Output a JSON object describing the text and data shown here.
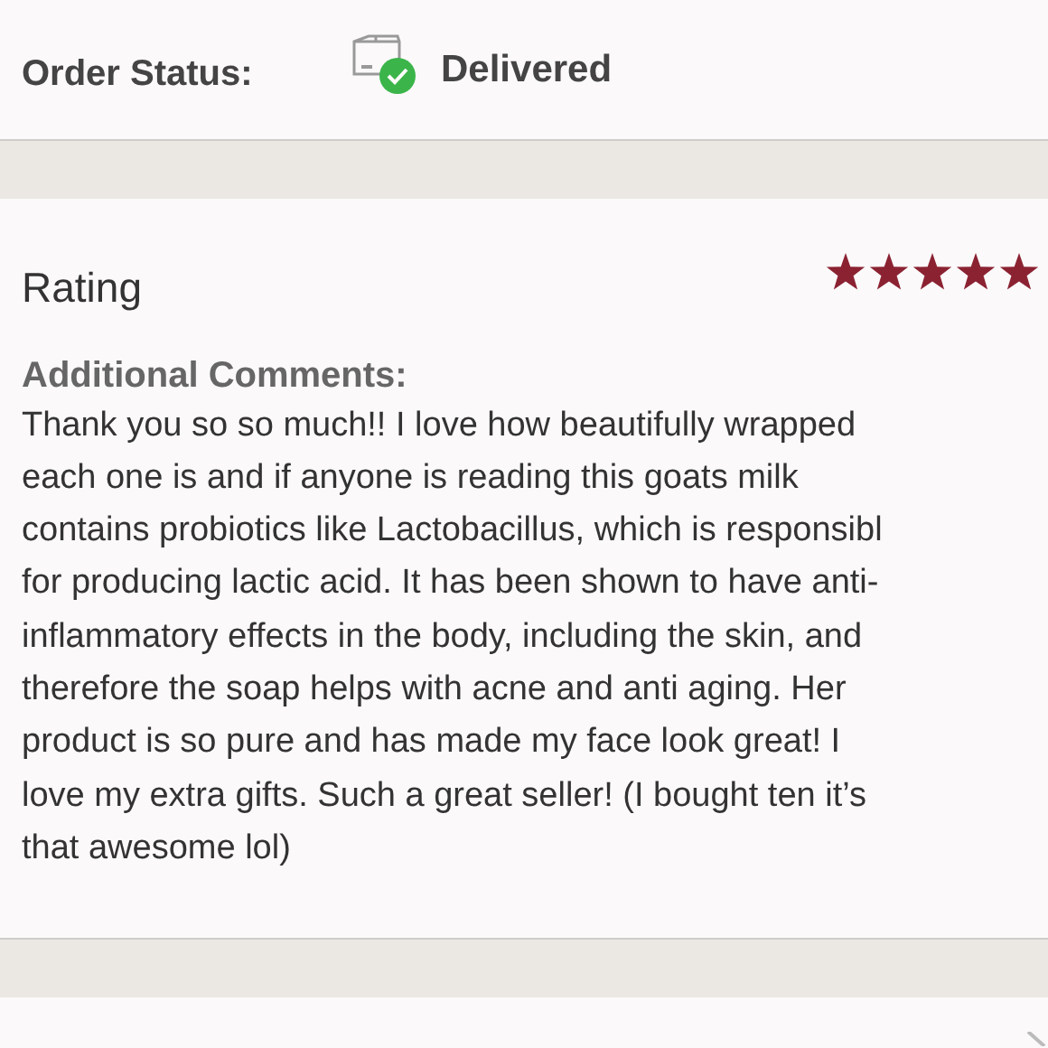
{
  "order_status": {
    "label": "Order Status:",
    "value": "Delivered"
  },
  "rating": {
    "title": "Rating",
    "stars": 5
  },
  "comments": {
    "label": "Additional Comments:",
    "lines": [
      "Thank you so so much!! I love how beautifully wrapped",
      "each one is and if anyone is reading this goats milk",
      "contains probiotics like Lactobacillus, which is responsibl",
      "for producing lactic acid. It has been shown to have anti-",
      "inflammatory effects in the body, including the skin, and",
      "therefore the soap helps with acne and anti aging. Her",
      "product is so pure and has made my face look great! I",
      "love my extra gifts. Such a great seller! (I bought ten it’s",
      "that awesome lol)"
    ]
  }
}
